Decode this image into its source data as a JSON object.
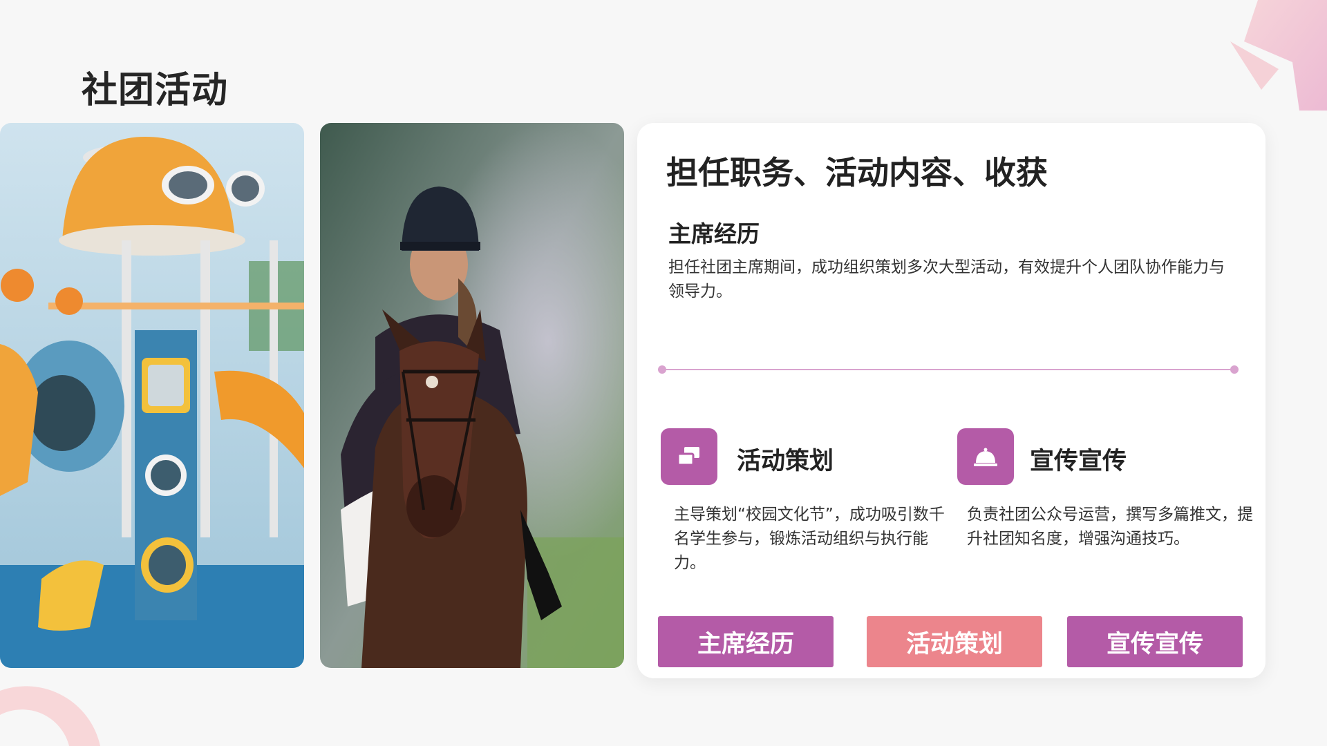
{
  "page": {
    "title": "社团活动"
  },
  "photos": [
    {
      "icon": "playground-photo"
    },
    {
      "icon": "horse-rider-photo"
    }
  ],
  "card": {
    "heading": "担任职务、活动内容、收获",
    "section": {
      "title": "主席经历",
      "text": "担任社团主席期间，成功组织策划多次大型活动，有效提升个人团队协作能力与领导力。"
    },
    "features": [
      {
        "icon": "windows-icon",
        "title": "活动策划",
        "text": "主导策划“校园文化节”，成功吸引数千名学生参与，锻炼活动组织与执行能力。"
      },
      {
        "icon": "service-bell-icon",
        "title": "宣传宣传",
        "text": "负责社团公众号运营，撰写多篇推文，提升社团知名度，增强沟通技巧。"
      }
    ],
    "tabs": [
      {
        "label": "主席经历",
        "color": "#b45ba7"
      },
      {
        "label": "活动策划",
        "color": "#ec858c"
      },
      {
        "label": "宣传宣传",
        "color": "#b45ba7"
      }
    ]
  },
  "colors": {
    "accent": "#b45ba7",
    "accent_pink": "#ec858c",
    "divider": "#d9a3cf"
  }
}
